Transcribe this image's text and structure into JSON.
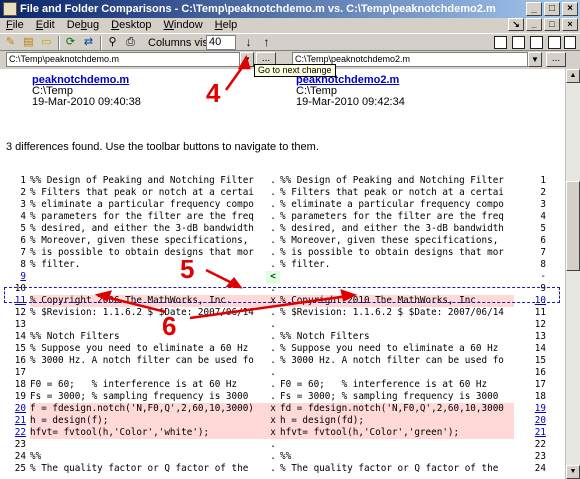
{
  "window": {
    "title": "File and Folder Comparisons - C:\\Temp\\peaknotchdemo.m vs. C:\\Temp\\peaknotchdemo2.m",
    "controls": [
      "_",
      "□",
      "×"
    ]
  },
  "menu": [
    {
      "label": "File",
      "key": "F"
    },
    {
      "label": "Edit",
      "key": "E"
    },
    {
      "label": "Debug",
      "key": "b"
    },
    {
      "label": "Desktop",
      "key": "D"
    },
    {
      "label": "Window",
      "key": "W"
    },
    {
      "label": "Help",
      "key": "H"
    }
  ],
  "toolbar": {
    "columns_label": "Columns visible:",
    "columns_value": "40",
    "next_change_tooltip": "Go to next change"
  },
  "left": {
    "path": "C:\\Temp\\peaknotchdemo.m",
    "filename": "peaknotchdemo.m",
    "folder": "C:\\Temp",
    "date": "19-Mar-2010 09:40:38"
  },
  "right": {
    "path": "C:\\Temp\\peaknotchdemo2.m",
    "filename": "peaknotchdemo2.m",
    "folder": "C:\\Temp",
    "date": "19-Mar-2010 09:42:34"
  },
  "summary": "3 differences found. Use the toolbar buttons to navigate to them.",
  "annotations": [
    "4",
    "5",
    "6"
  ],
  "rows": [
    {
      "ln": "1",
      "left": "%% Design of Peaking and Notching Filter",
      "mk": ".",
      "rn": "1",
      "right": "%% Design of Peaking and Notching Filter",
      "type": "same"
    },
    {
      "ln": "2",
      "left": "% Filters that peak or notch at a certai",
      "mk": ".",
      "rn": "2",
      "right": "% Filters that peak or notch at a certai",
      "type": "same"
    },
    {
      "ln": "3",
      "left": "% eliminate a particular frequency compo",
      "mk": ".",
      "rn": "3",
      "right": "% eliminate a particular frequency compo",
      "type": "same"
    },
    {
      "ln": "4",
      "left": "% parameters for the filter are the freq",
      "mk": ".",
      "rn": "4",
      "right": "% parameters for the filter are the freq",
      "type": "same"
    },
    {
      "ln": "5",
      "left": "% desired, and either the 3-dB bandwidth",
      "mk": ".",
      "rn": "5",
      "right": "% desired, and either the 3-dB bandwidth",
      "type": "same"
    },
    {
      "ln": "6",
      "left": "% Moreover, given these specifications,",
      "mk": ".",
      "rn": "6",
      "right": "% Moreover, given these specifications,",
      "type": "same"
    },
    {
      "ln": "7",
      "left": "% is possible to obtain designs that mor",
      "mk": ".",
      "rn": "7",
      "right": "% is possible to obtain designs that mor",
      "type": "same"
    },
    {
      "ln": "8",
      "left": "% filter.",
      "mk": ".",
      "rn": "8",
      "right": "% filter.",
      "type": "same"
    },
    {
      "ln": "9",
      "left": "",
      "mk": "<",
      "rn": "-",
      "right": "",
      "type": "added",
      "link_l": true
    },
    {
      "ln": "10",
      "left": "",
      "mk": ".",
      "rn": "9",
      "right": "",
      "type": "same"
    },
    {
      "ln": "11",
      "left": "% Copyright 2006 The MathWorks, Inc.",
      "mk": "x",
      "rn": "10",
      "right": "% Copyright 2010 The MathWorks, Inc.",
      "type": "changed",
      "link_l": true,
      "link_r": true
    },
    {
      "ln": "12",
      "left": "% $Revision: 1.1.6.2 $ $Date: 2007/06/14",
      "mk": ".",
      "rn": "11",
      "right": "% $Revision: 1.1.6.2 $ $Date: 2007/06/14",
      "type": "same"
    },
    {
      "ln": "13",
      "left": "",
      "mk": ".",
      "rn": "12",
      "right": "",
      "type": "same"
    },
    {
      "ln": "14",
      "left": "%% Notch Filters",
      "mk": ".",
      "rn": "13",
      "right": "%% Notch Filters",
      "type": "same"
    },
    {
      "ln": "15",
      "left": "% Suppose you need to eliminate a 60 Hz",
      "mk": ".",
      "rn": "14",
      "right": "% Suppose you need to eliminate a 60 Hz",
      "type": "same"
    },
    {
      "ln": "16",
      "left": "% 3000 Hz. A notch filter can be used fo",
      "mk": ".",
      "rn": "15",
      "right": "% 3000 Hz. A notch filter can be used fo",
      "type": "same"
    },
    {
      "ln": "17",
      "left": "",
      "mk": ".",
      "rn": "16",
      "right": "",
      "type": "same"
    },
    {
      "ln": "18",
      "left": "F0 = 60;   % interference is at 60 Hz",
      "mk": ".",
      "rn": "17",
      "right": "F0 = 60;   % interference is at 60 Hz",
      "type": "same"
    },
    {
      "ln": "19",
      "left": "Fs = 3000; % sampling frequency is 3000",
      "mk": ".",
      "rn": "18",
      "right": "Fs = 3000; % sampling frequency is 3000",
      "type": "same"
    },
    {
      "ln": "20",
      "left": "f = fdesign.notch('N,F0,Q',2,60,10,3000)",
      "mk": "x",
      "rn": "19",
      "right": "fd = fdesign.notch('N,F0,Q',2,60,10,3000",
      "type": "changed",
      "link_l": true,
      "link_r": true
    },
    {
      "ln": "21",
      "left": "h = design(f);",
      "mk": "x",
      "rn": "20",
      "right": "h = design(fd);",
      "type": "changed",
      "link_l": true,
      "link_r": true
    },
    {
      "ln": "22",
      "left": "hfvt= fvtool(h,'Color','white');",
      "mk": "x",
      "rn": "21",
      "right": "hfvt= fvtool(h,'Color','green');",
      "type": "changed",
      "link_l": true,
      "link_r": true
    },
    {
      "ln": "23",
      "left": "",
      "mk": ".",
      "rn": "22",
      "right": "",
      "type": "same"
    },
    {
      "ln": "24",
      "left": "%%",
      "mk": ".",
      "rn": "23",
      "right": "%%",
      "type": "same"
    },
    {
      "ln": "25",
      "left": "% The quality factor or Q factor of the",
      "mk": ".",
      "rn": "24",
      "right": "% The quality factor or Q factor of the",
      "type": "same"
    }
  ],
  "colors": {
    "changed": "#ffd8d8",
    "added": "#ddffdd",
    "annotation": "#e00000",
    "link": "#0000cc"
  }
}
